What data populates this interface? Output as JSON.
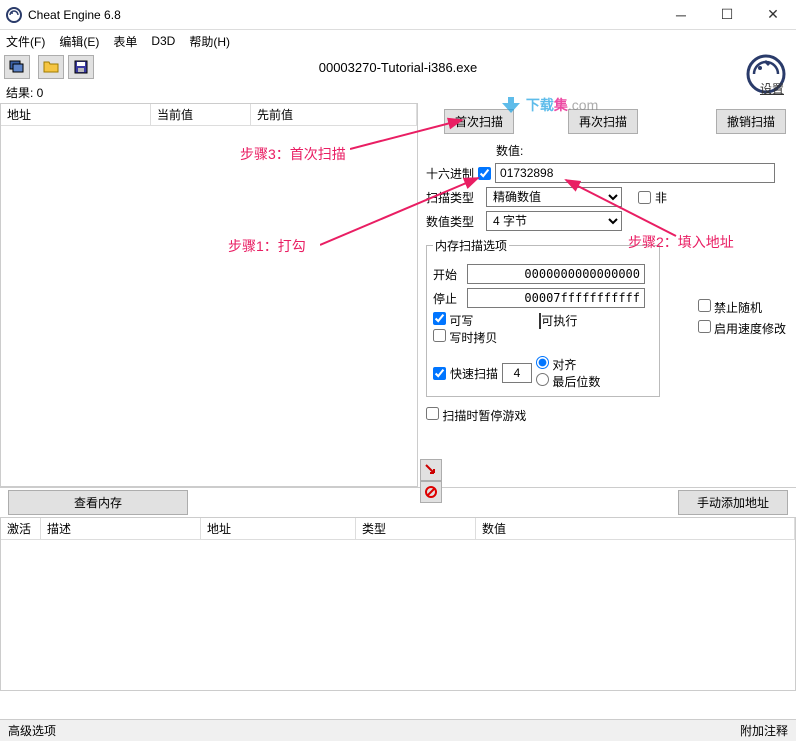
{
  "window": {
    "title": "Cheat Engine 6.8"
  },
  "menu": {
    "file": "文件(F)",
    "edit": "编辑(E)",
    "table": "表单",
    "d3d": "D3D",
    "help": "帮助(H)"
  },
  "process_name": "00003270-Tutorial-i386.exe",
  "settings": "设置",
  "results_label": "结果: 0",
  "addr_table": {
    "col_addr": "地址",
    "col_curr": "当前值",
    "col_prev": "先前值"
  },
  "scan": {
    "first": "首次扫描",
    "rescan": "再次扫描",
    "undo": "撤销扫描",
    "value_label": "数值:",
    "hex_label": "十六进制",
    "value": "01732898",
    "scantype_label": "扫描类型",
    "scantype": "精确数值",
    "not": "非",
    "valuetype_label": "数值类型",
    "valuetype": "4 字节"
  },
  "memscan": {
    "title": "内存扫描选项",
    "start_label": "开始",
    "start": "0000000000000000",
    "stop_label": "停止",
    "stop": "00007fffffffffff",
    "writable": "可写",
    "executable": "可执行",
    "cow": "写时拷贝",
    "fastscan": "快速扫描",
    "fastscan_val": "4",
    "aligned": "对齐",
    "lastdigits": "最后位数",
    "pause": "扫描时暂停游戏"
  },
  "side": {
    "norandom": "禁止随机",
    "speedhack": "启用速度修改"
  },
  "buttons": {
    "viewmem": "查看内存",
    "manualadd": "手动添加地址"
  },
  "cheat_table": {
    "active": "激活",
    "desc": "描述",
    "addr": "地址",
    "type": "类型",
    "value": "数值"
  },
  "statusbar": {
    "adv": "高级选项",
    "attach": "附加注释"
  },
  "annotations": {
    "step1": "步骤1：打勾",
    "step2": "步骤2：填入地址",
    "step3": "步骤3：首次扫描"
  }
}
